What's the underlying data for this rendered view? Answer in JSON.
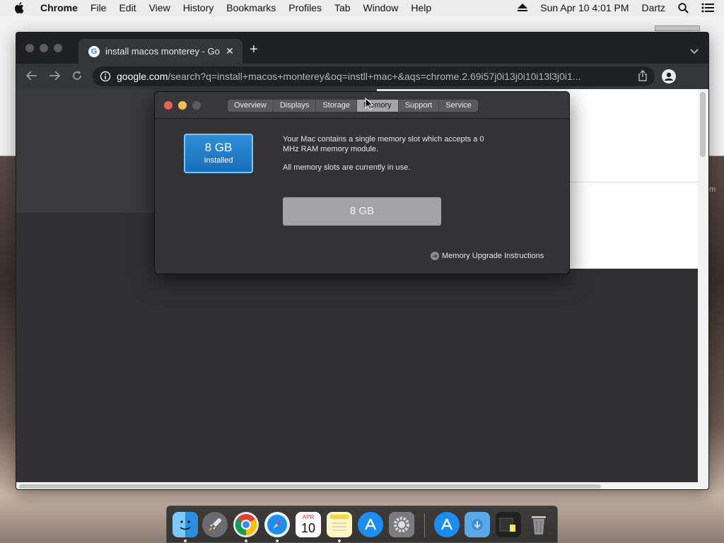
{
  "menubar": {
    "app_name": "Chrome",
    "items": [
      "File",
      "Edit",
      "View",
      "History",
      "Bookmarks",
      "Profiles",
      "Tab",
      "Window",
      "Help"
    ],
    "clock": "Sun Apr 10  4:01 PM",
    "user": "Dartz"
  },
  "chrome": {
    "tab_title": "install macos monterey - Goog",
    "favicon_letter": "G",
    "url_host": "google.com",
    "url_path": "/search?q=install+macos+monterey&oq=instll+mac+&aqs=chrome.2.69i57j0i13j0i10i13l3j0i1..."
  },
  "dialog": {
    "tabs": [
      "Overview",
      "Displays",
      "Storage",
      "Memory",
      "Support",
      "Service"
    ],
    "active_tab": "Memory",
    "memory_size": "8 GB",
    "memory_label": "Installed",
    "description_1": "Your Mac contains a single memory slot which accepts a 0 MHz RAM memory module.",
    "description_2": "All memory slots are currently in use.",
    "slot_size": "8 GB",
    "upgrade_link": "Memory Upgrade Instructions"
  },
  "calendar": {
    "month": "APR",
    "day": "10"
  },
  "side_text": "m",
  "colors": {
    "close": "#ed5f57",
    "minimize": "#f5bf4f",
    "zoom_inactive": "#5b5b5e",
    "memory_blue": "#1a7cc9"
  }
}
